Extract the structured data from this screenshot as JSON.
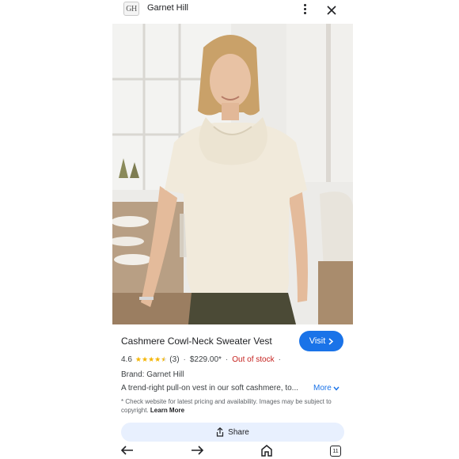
{
  "header": {
    "favicon_text": "GH",
    "site_name": "Garnet Hill",
    "more_icon": "more-vert-icon",
    "close_icon": "close-icon"
  },
  "product": {
    "title": "Cashmere Cowl-Neck Sweater Vest",
    "visit_label": "Visit",
    "rating": "4.6",
    "rating_value": 4.6,
    "rating_max": 5,
    "review_count": "(3)",
    "price": "$229.00*",
    "stock_status": "Out of stock",
    "brand": "Brand: Garnet Hill",
    "description": "A trend-right pull-on vest in our soft cashmere, to...",
    "more_label": "More",
    "disclaimer": "* Check website for latest pricing and availability. Images may be subject to copyright.",
    "learn_more": "Learn More",
    "share_label": "Share"
  },
  "colors": {
    "accent": "#1a73e8",
    "star": "#f4b400",
    "out_of_stock": "#c5221f",
    "share_bg": "#e8f0fe"
  },
  "navbar": {
    "back_icon": "arrow-back-icon",
    "forward_icon": "arrow-forward-icon",
    "home_icon": "home-icon",
    "tab_count": "11"
  }
}
